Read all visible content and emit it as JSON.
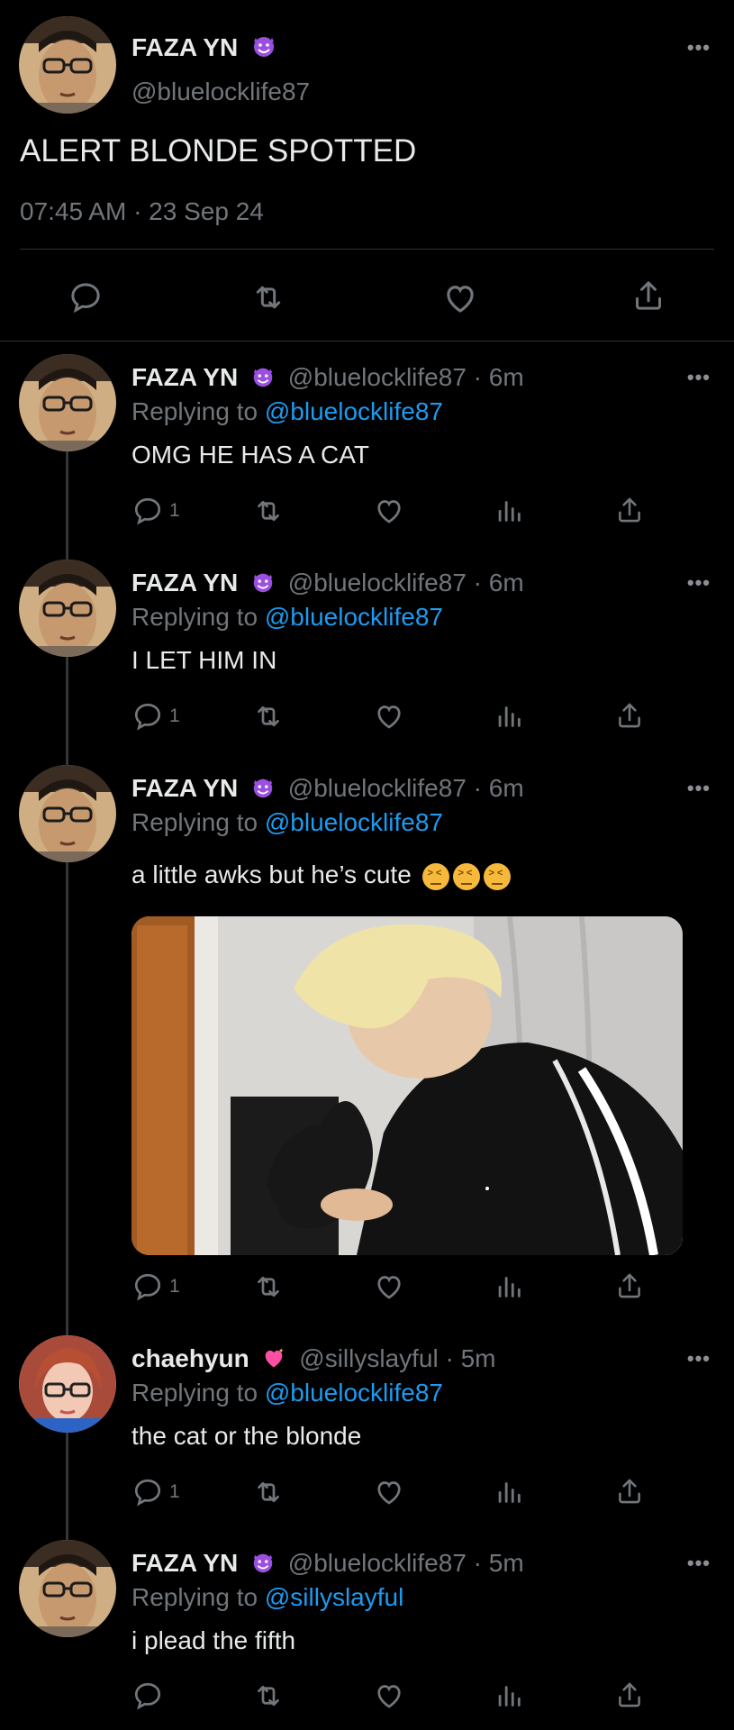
{
  "main_tweet": {
    "name": "FAZA YN",
    "handle": "@bluelocklife87",
    "text": "ALERT BLONDE SPOTTED",
    "timestamp": "07:45 AM · 23 Sep 24"
  },
  "replies": [
    {
      "name": "FAZA YN",
      "handle": "@bluelocklife87",
      "time": "6m",
      "replying_prefix": "Replying to",
      "replying_to": "@bluelocklife87",
      "text": "OMG HE HAS A CAT",
      "reply_count": "1"
    },
    {
      "name": "FAZA YN",
      "handle": "@bluelocklife87",
      "time": "6m",
      "replying_prefix": "Replying to",
      "replying_to": "@bluelocklife87",
      "text": "I LET HIM IN",
      "reply_count": "1"
    },
    {
      "name": "FAZA YN",
      "handle": "@bluelocklife87",
      "time": "6m",
      "replying_prefix": "Replying to",
      "replying_to": "@bluelocklife87",
      "text": "a little awks but he’s cute",
      "reply_count": "1"
    },
    {
      "name": "chaehyun",
      "handle": "@sillyslayful",
      "time": "5m",
      "replying_prefix": "Replying to",
      "replying_to": "@bluelocklife87",
      "text": "the cat or the blonde",
      "reply_count": "1"
    },
    {
      "name": "FAZA YN",
      "handle": "@bluelocklife87",
      "time": "5m",
      "replying_prefix": "Replying to",
      "replying_to": "@sillyslayful",
      "text": "i plead the fifth",
      "reply_count": ""
    }
  ],
  "icons": {
    "badge_devil": "smiling-devil-emoji-icon",
    "badge_heart": "sparkling-heart-emoji-icon",
    "reply": "reply-bubble-icon",
    "retweet": "retweet-icon",
    "like": "heart-icon",
    "views": "views-bar-chart-icon",
    "share": "share-icon",
    "more": "more-dots-icon",
    "emoji_face": "confounded-face-emoji-icon"
  },
  "colors": {
    "background": "#000000",
    "text": "#e7e9ea",
    "muted": "#71767b",
    "link": "#1d9bf0",
    "divider": "#2f3336"
  }
}
